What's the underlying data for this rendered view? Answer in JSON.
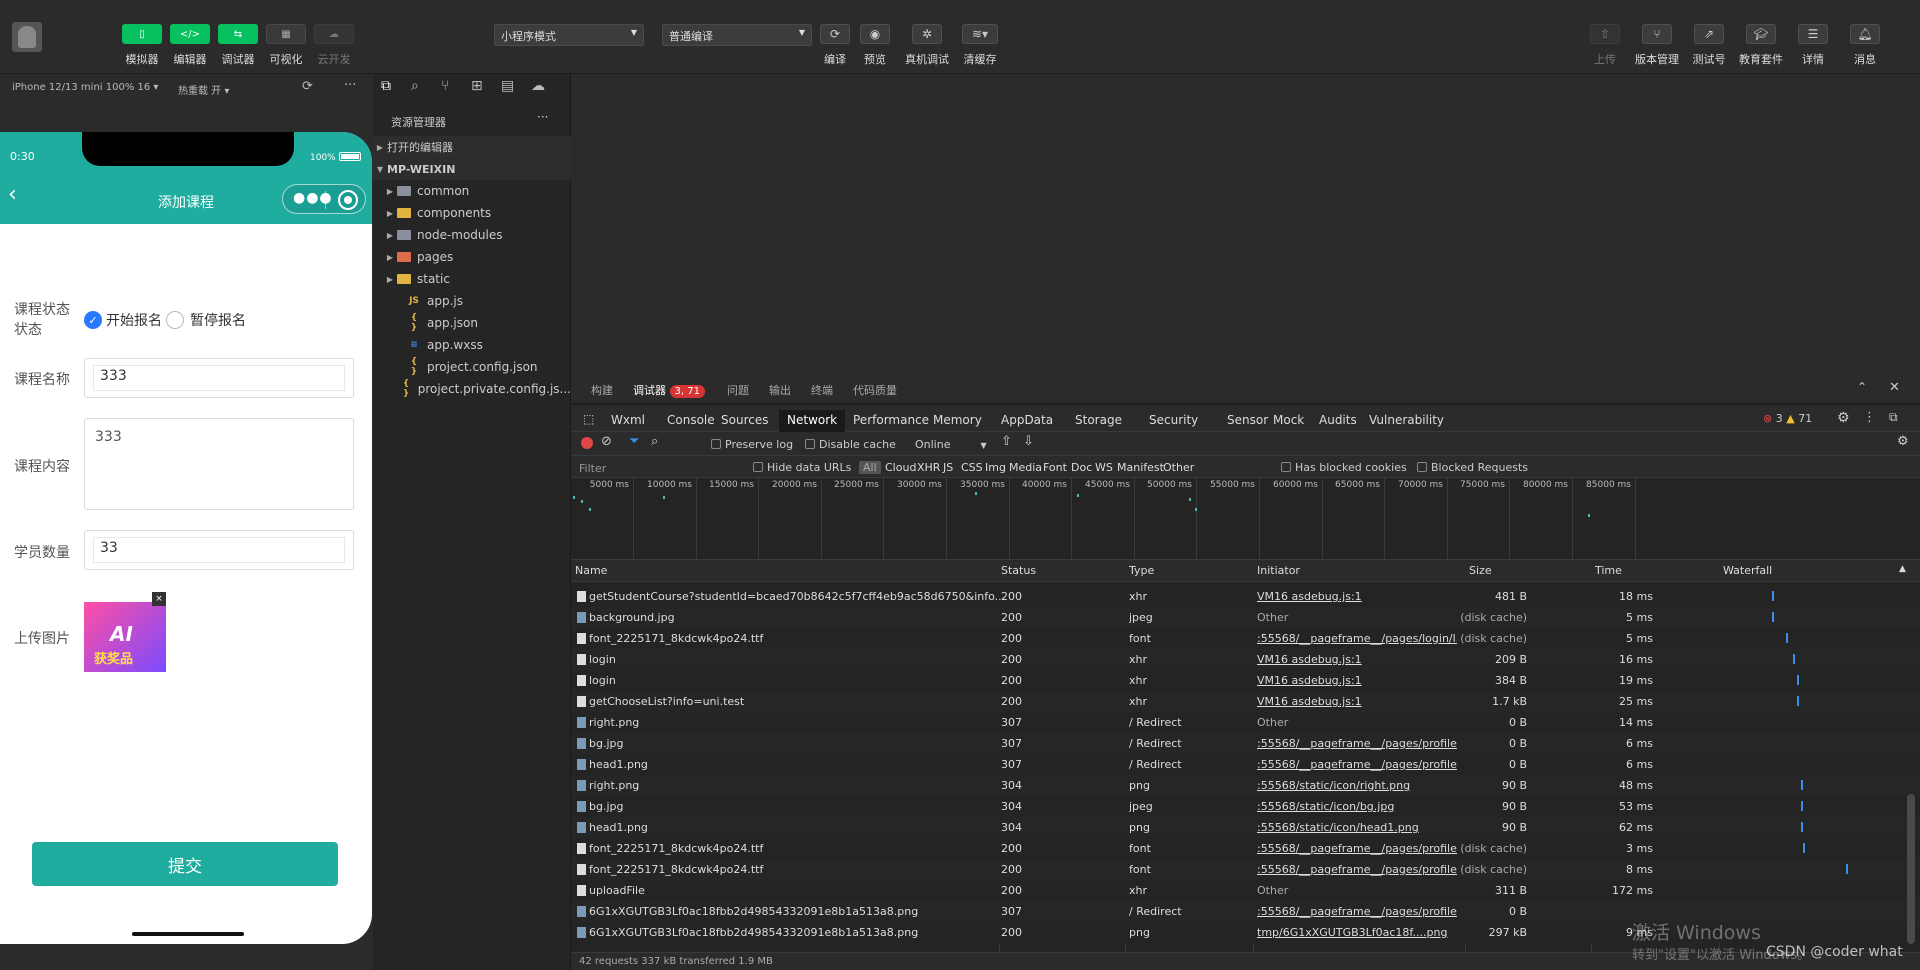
{
  "toolbar": {
    "buttons": [
      {
        "label": "模拟器"
      },
      {
        "label": "编辑器"
      },
      {
        "label": "调试器"
      },
      {
        "label": "可视化"
      },
      {
        "label": "云开发"
      }
    ],
    "mode_select": "小程序模式",
    "compile_select": "普通编译",
    "mid_actions": [
      {
        "label": "编译"
      },
      {
        "label": "预览"
      },
      {
        "label": "真机调试"
      },
      {
        "label": "清缓存"
      }
    ],
    "right_actions": [
      {
        "label": "上传"
      },
      {
        "label": "版本管理"
      },
      {
        "label": "测试号"
      },
      {
        "label": "教育套件"
      },
      {
        "label": "详情"
      },
      {
        "label": "消息"
      }
    ]
  },
  "simbar": {
    "device": "iPhone 12/13 mini 100% 16 ▾",
    "hotreload": "热重载 开 ▾"
  },
  "phone": {
    "time": "0:30",
    "battery": "100%",
    "title": "添加课程",
    "status_label": "课程状态",
    "status_label_sub": "状态",
    "opt1": "开始报名",
    "opt2": "暂停报名",
    "name_label": "课程名称",
    "name_value": "333",
    "content_label": "课程内容",
    "content_value": "333",
    "count_label": "学员数量",
    "count_value": "33",
    "upload_label": "上传图片",
    "upload_img_text1": "AI",
    "upload_img_text2": "获奖品",
    "submit": "提交"
  },
  "explorer": {
    "title": "资源管理器",
    "open_editors": "打开的编辑器",
    "project": "MP-WEIXIN",
    "items": [
      {
        "name": "common",
        "kind": "folder"
      },
      {
        "name": "components",
        "kind": "folder-y"
      },
      {
        "name": "node-modules",
        "kind": "folder"
      },
      {
        "name": "pages",
        "kind": "folder-r"
      },
      {
        "name": "static",
        "kind": "folder-y"
      },
      {
        "name": "app.js",
        "kind": "js"
      },
      {
        "name": "app.json",
        "kind": "json"
      },
      {
        "name": "app.wxss",
        "kind": "wxss"
      },
      {
        "name": "project.config.json",
        "kind": "json"
      },
      {
        "name": "project.private.config.js...",
        "kind": "json"
      }
    ]
  },
  "debug": {
    "top_tabs": [
      "构建",
      "调试器",
      "问题",
      "输出",
      "终端",
      "代码质量"
    ],
    "badge": "3, 71",
    "chrome_tabs": [
      "Wxml",
      "Console",
      "Sources",
      "Network",
      "Performance",
      "Memory",
      "AppData",
      "Storage",
      "Security",
      "Sensor",
      "Mock",
      "Audits",
      "Vulnerability"
    ],
    "err_count": "3",
    "warn_count": "71",
    "preserve_log": "Preserve log",
    "disable_cache": "Disable cache",
    "online": "Online",
    "filter_placeholder": "Filter",
    "hide_data_urls": "Hide data URLs",
    "filter_types": [
      "All",
      "Cloud",
      "XHR",
      "JS",
      "CSS",
      "Img",
      "Media",
      "Font",
      "Doc",
      "WS",
      "Manifest",
      "Other"
    ],
    "has_blocked": "Has blocked cookies",
    "blocked_requests": "Blocked Requests",
    "ticks": [
      "5000 ms",
      "10000 ms",
      "15000 ms",
      "20000 ms",
      "25000 ms",
      "30000 ms",
      "35000 ms",
      "40000 ms",
      "45000 ms",
      "50000 ms",
      "55000 ms",
      "60000 ms",
      "65000 ms",
      "70000 ms",
      "75000 ms",
      "80000 ms",
      "85000 ms"
    ],
    "columns": [
      "Name",
      "Status",
      "Type",
      "Initiator",
      "Size",
      "Time",
      "Waterfall"
    ],
    "rows": [
      {
        "name": "getStudentCourse?studentId=bcaed70b8642c5f7cff4eb9ac58d6750&info...",
        "status": "200",
        "type": "xhr",
        "initiator": "VM16 asdebug.js:1",
        "ul": true,
        "size": "481 B",
        "time": "18 ms",
        "wf": 0.27
      },
      {
        "name": "background.jpg",
        "status": "200",
        "type": "jpeg",
        "initiator": "Other",
        "ul": false,
        "size": "(disk cache)",
        "time": "5 ms",
        "wf": 0.27
      },
      {
        "name": "font_2225171_8kdcwk4po24.ttf",
        "status": "200",
        "type": "font",
        "initiator": ":55568/__pageframe__/pages/login/l...",
        "ul": true,
        "size": "(disk cache)",
        "time": "5 ms",
        "wf": 0.34
      },
      {
        "name": "login",
        "status": "200",
        "type": "xhr",
        "initiator": "VM16 asdebug.js:1",
        "ul": true,
        "size": "209 B",
        "time": "16 ms",
        "wf": 0.38
      },
      {
        "name": "login",
        "status": "200",
        "type": "xhr",
        "initiator": "VM16 asdebug.js:1",
        "ul": true,
        "size": "384 B",
        "time": "19 ms",
        "wf": 0.4
      },
      {
        "name": "getChooseList?info=uni.test",
        "status": "200",
        "type": "xhr",
        "initiator": "VM16 asdebug.js:1",
        "ul": true,
        "size": "1.7 kB",
        "time": "25 ms",
        "wf": 0.4
      },
      {
        "name": "right.png",
        "status": "307",
        "type": "/ Redirect",
        "initiator": "Other",
        "ul": false,
        "size": "0 B",
        "time": "14 ms",
        "wf": -1
      },
      {
        "name": "bg.jpg",
        "status": "307",
        "type": "/ Redirect",
        "initiator": ":55568/__pageframe__/pages/profile...",
        "ul": true,
        "size": "0 B",
        "time": "6 ms",
        "wf": -1
      },
      {
        "name": "head1.png",
        "status": "307",
        "type": "/ Redirect",
        "initiator": ":55568/__pageframe__/pages/profile...",
        "ul": true,
        "size": "0 B",
        "time": "6 ms",
        "wf": -1
      },
      {
        "name": "right.png",
        "status": "304",
        "type": "png",
        "initiator": ":55568/static/icon/right.png",
        "ul": true,
        "size": "90 B",
        "time": "48 ms",
        "wf": 0.42
      },
      {
        "name": "bg.jpg",
        "status": "304",
        "type": "jpeg",
        "initiator": ":55568/static/icon/bg.jpg",
        "ul": true,
        "size": "90 B",
        "time": "53 ms",
        "wf": 0.42
      },
      {
        "name": "head1.png",
        "status": "304",
        "type": "png",
        "initiator": ":55568/static/icon/head1.png",
        "ul": true,
        "size": "90 B",
        "time": "62 ms",
        "wf": 0.42
      },
      {
        "name": "font_2225171_8kdcwk4po24.ttf",
        "status": "200",
        "type": "font",
        "initiator": ":55568/__pageframe__/pages/profile...",
        "ul": true,
        "size": "(disk cache)",
        "time": "3 ms",
        "wf": 0.43
      },
      {
        "name": "font_2225171_8kdcwk4po24.ttf",
        "status": "200",
        "type": "font",
        "initiator": ":55568/__pageframe__/pages/profile...",
        "ul": true,
        "size": "(disk cache)",
        "time": "8 ms",
        "wf": 0.66
      },
      {
        "name": "uploadFile",
        "status": "200",
        "type": "xhr",
        "initiator": "Other",
        "ul": false,
        "size": "311 B",
        "time": "172 ms",
        "wf": 0.98
      },
      {
        "name": "6G1xXGUTGB3Lf0ac18fbb2d49854332091e8b1a513a8.png",
        "status": "307",
        "type": "/ Redirect",
        "initiator": ":55568/__pageframe__/pages/profile...",
        "ul": true,
        "size": "0 B",
        "time": "",
        "wf": -1
      },
      {
        "name": "6G1xXGUTGB3Lf0ac18fbb2d49854332091e8b1a513a8.png",
        "status": "200",
        "type": "png",
        "initiator": "tmp/6G1xXGUTGB3Lf0ac18f....png",
        "ul": true,
        "size": "297 kB",
        "time": "9 ms",
        "wf": -1
      }
    ],
    "footer": "42 requests  337 kB transferred  1.9 MB"
  },
  "watermark": {
    "line1": "激活 Windows",
    "line2": "转到\"设置\"以激活 Windows。",
    "csdn": "CSDN @coder what"
  }
}
